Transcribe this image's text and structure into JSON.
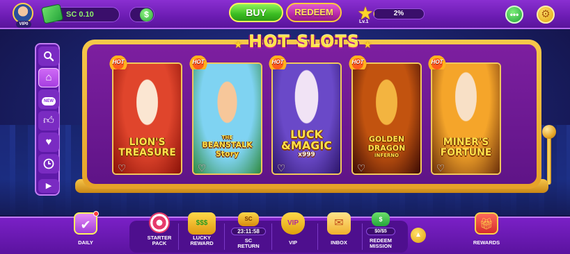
{
  "topbar": {
    "vip_level": "VIP0",
    "sc_balance": "SC 0.10",
    "toggle_symbol": "$",
    "buy_label": "BUY",
    "redeem_label": "REDEEM",
    "level_label": "Lv.1",
    "xp_progress": "2%",
    "xp_fraction": 0.02
  },
  "side_nav": {
    "items": [
      {
        "icon": "search-icon"
      },
      {
        "icon": "home-icon",
        "active": true
      },
      {
        "icon": "new-icon",
        "text": "NEW"
      },
      {
        "icon": "thumbs-up-icon"
      },
      {
        "icon": "heart-icon"
      },
      {
        "icon": "clock-icon"
      },
      {
        "icon": "chevron-right-icon"
      }
    ]
  },
  "lobby": {
    "title": "HOT SLOTS",
    "hot_badge": "HOT",
    "games": [
      {
        "title_line1": "LION'S",
        "title_line2": "TREASURE",
        "art_top": "#e0452c",
        "art_bottom": "#8a1208"
      },
      {
        "title_line0": "THE",
        "title_line1": "BEANSTALK",
        "title_line2": "Story",
        "art_top": "#7fd3f2",
        "art_bottom": "#2f8a3e"
      },
      {
        "title_line1": "LUCK",
        "title_line2": "&MAGIC",
        "title_line3": "x999",
        "art_top": "#6a49c8",
        "art_bottom": "#2c1568"
      },
      {
        "title_line1": "GOLDEN",
        "title_line2": "DRAGON",
        "title_line3": "INFERNO",
        "art_top": "#c2530f",
        "art_bottom": "#3a0a04"
      },
      {
        "title_line1": "MINER'S",
        "title_line2": "FORTUNE",
        "art_top": "#f5a52a",
        "art_bottom": "#6a2e0a"
      }
    ]
  },
  "bottom_bar": {
    "daily": "DAILY",
    "starter_pack_1": "STARTER",
    "starter_pack_2": "PACK",
    "lucky_reward_1": "LUCKY",
    "lucky_reward_2": "REWARD",
    "sc_timer": "23:11:58",
    "sc_return_1": "SC",
    "sc_return_2": "RETURN",
    "vip": "VIP",
    "inbox": "INBOX",
    "redeem_progress": "$0/$5",
    "redeem_mission_1": "REDEEM",
    "redeem_mission_2": "MISSION",
    "rewards": "REWARDS"
  }
}
